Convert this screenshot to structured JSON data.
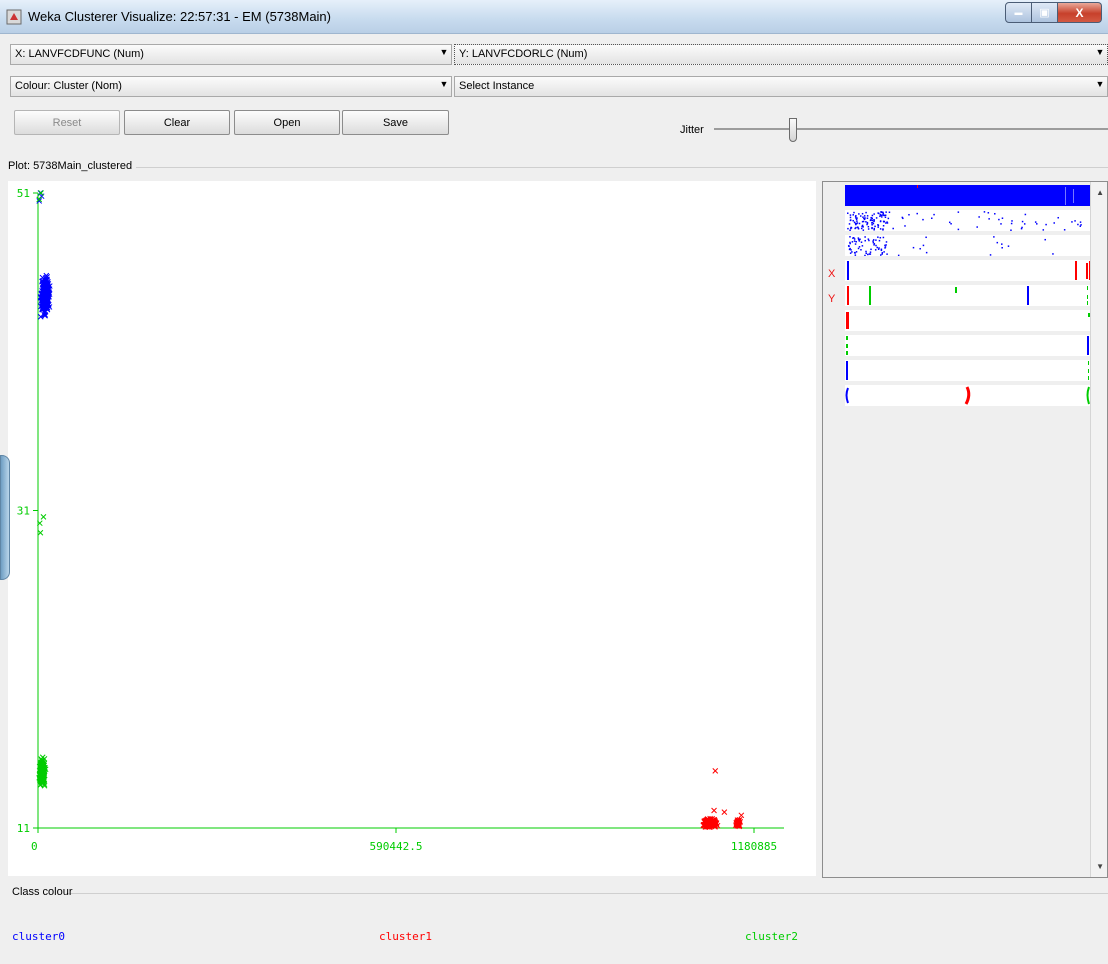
{
  "window": {
    "title": "Weka Clusterer Visualize: 22:57:31 - EM (5738Main)",
    "minimize_glyph": "▬",
    "maximize_glyph": "▣",
    "close_glyph": "X"
  },
  "controls": {
    "x_axis": "X: LANVFCDFUNC (Num)",
    "y_axis": "Y: LANVFCDORLC (Num)",
    "colour": "Colour: Cluster (Nom)",
    "instance": "Select Instance",
    "combo_arrow": "▼",
    "buttons": {
      "reset": "Reset",
      "clear": "Clear",
      "open": "Open",
      "save": "Save"
    },
    "jitter_label": "Jitter",
    "jitter_level": 0.2
  },
  "plot": {
    "label": "Plot: 5738Main_clustered"
  },
  "attr_panel": {
    "x_marker": "X",
    "y_marker": "Y",
    "scroll_up": "▲",
    "scroll_down": "▼"
  },
  "class_colour": {
    "label": "Class colour",
    "clusters": [
      {
        "name": "cluster0",
        "color": "#0000ff"
      },
      {
        "name": "cluster1",
        "color": "#ff0000"
      },
      {
        "name": "cluster2",
        "color": "#00cc00"
      }
    ]
  },
  "chart_data": {
    "type": "scatter",
    "title": "",
    "xlabel": "LANVFCDFUNC",
    "ylabel": "LANVFCDORLC",
    "xlim": [
      0,
      1180885
    ],
    "ylim": [
      11,
      51
    ],
    "x_ticks": [
      {
        "value": 0,
        "label": "0"
      },
      {
        "value": 590442.5,
        "label": "590442.5"
      },
      {
        "value": 1180885,
        "label": "1180885"
      }
    ],
    "y_ticks": [
      {
        "value": 11,
        "label": "11"
      },
      {
        "value": 31,
        "label": "31"
      },
      {
        "value": 51,
        "label": "51"
      }
    ],
    "marker": "x",
    "grid": false,
    "series": [
      {
        "name": "cluster0",
        "color": "#0000ff",
        "clusters": [
          {
            "x_center": 12000,
            "y_center": 44.5,
            "x_spread": 9000,
            "y_spread": 1.5,
            "count": 260
          }
        ],
        "points": [
          [
            2000,
            50.5
          ],
          [
            4000,
            51
          ],
          [
            6000,
            50.8
          ]
        ]
      },
      {
        "name": "cluster1",
        "color": "#ff0000",
        "clusters": [
          {
            "x_center": 1108000,
            "y_center": 11.3,
            "x_spread": 14000,
            "y_spread": 0.35,
            "count": 220
          },
          {
            "x_center": 1155000,
            "y_center": 11.3,
            "x_spread": 5000,
            "y_spread": 0.3,
            "count": 40
          }
        ],
        "points": [
          [
            1117000,
            14.6
          ],
          [
            1115000,
            12.1
          ],
          [
            1132000,
            12.0
          ],
          [
            1160000,
            11.8
          ]
        ]
      },
      {
        "name": "cluster2",
        "color": "#00cc00",
        "clusters": [
          {
            "x_center": 7000,
            "y_center": 14.5,
            "x_spread": 6500,
            "y_spread": 1.1,
            "count": 200
          }
        ],
        "points": [
          [
            3000,
            30.2
          ],
          [
            4000,
            29.6
          ],
          [
            9000,
            30.6
          ],
          [
            2000,
            50.6
          ],
          [
            5000,
            51
          ]
        ]
      }
    ]
  }
}
